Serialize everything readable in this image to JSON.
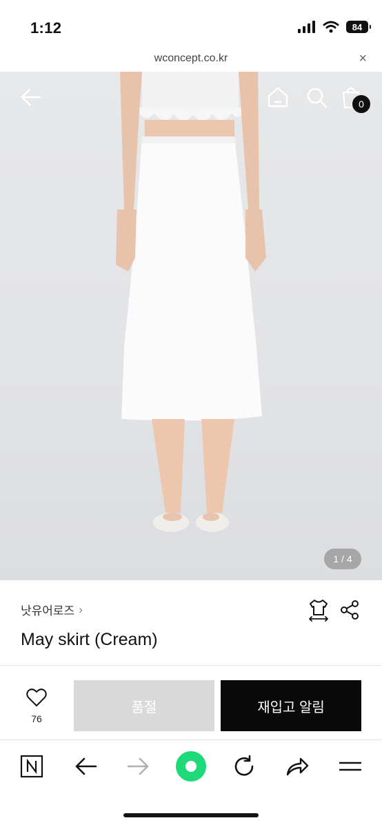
{
  "status": {
    "time": "1:12",
    "battery": "84"
  },
  "browser": {
    "url": "wconcept.co.kr",
    "close": "×"
  },
  "gallery": {
    "indicator": "1 / 4",
    "cart_count": "0"
  },
  "product": {
    "brand": "낫유어로즈",
    "brand_chevron": "›",
    "name": "May skirt (Cream)"
  },
  "actions": {
    "like_count": "76",
    "soldout_label": "품절",
    "restock_label": "재입고 알림"
  },
  "toolbar_icons": [
    "n-icon",
    "back-icon",
    "forward-icon",
    "green-dot-icon",
    "reload-icon",
    "share-icon",
    "menu-icon"
  ],
  "colors": {
    "accent_green": "#1ed97a",
    "button_dark": "#0a0a0a",
    "button_disabled": "#d9d9d9"
  }
}
